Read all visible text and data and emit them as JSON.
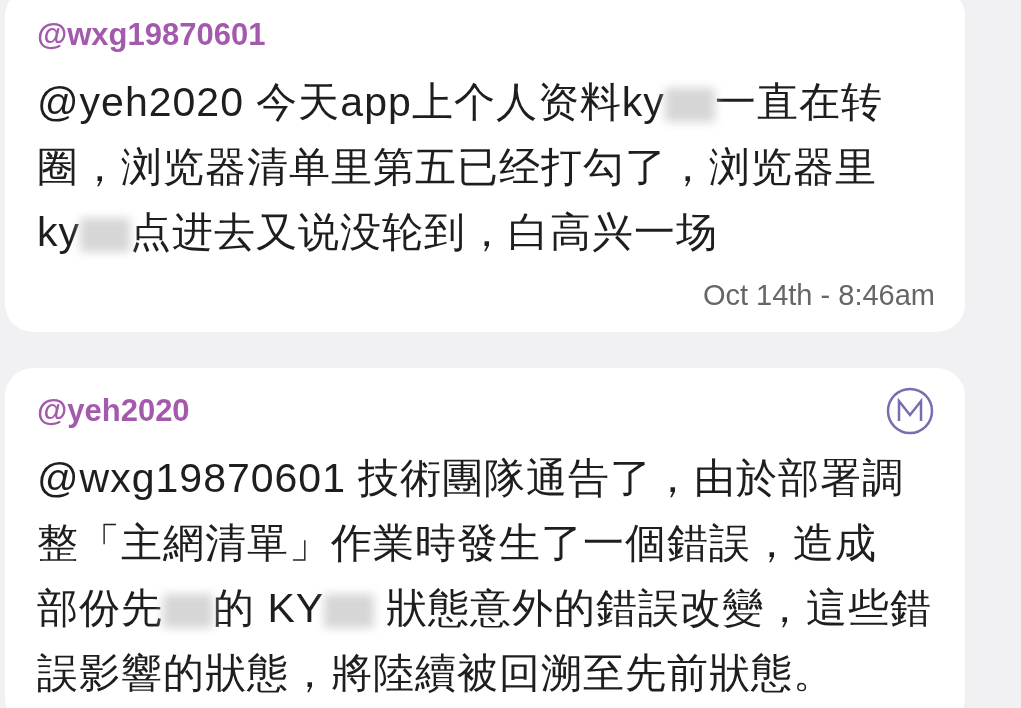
{
  "messages": [
    {
      "author": "@wxg19870601",
      "moderator": false,
      "lines": [
        [
          {
            "kind": "text",
            "text": "@yeh2020 今天app上个人资料ky"
          },
          {
            "kind": "blur"
          },
          {
            "kind": "text",
            "text": "一直在转"
          }
        ],
        [
          {
            "kind": "text",
            "text": "圈，浏览器清单里第五已经打勾了，浏览器里"
          }
        ],
        [
          {
            "kind": "text",
            "text": "ky"
          },
          {
            "kind": "blur"
          },
          {
            "kind": "text",
            "text": "点进去又说没轮到，白高兴一场"
          }
        ]
      ],
      "time": "Oct 14th - 8:46am"
    },
    {
      "author": "@yeh2020",
      "moderator": true,
      "lines": [
        [
          {
            "kind": "text",
            "text": "@wxg19870601 技術團隊通告了，由於部署調"
          }
        ],
        [
          {
            "kind": "text",
            "text": "整「主網清單」作業時發生了一個錯誤，造成"
          }
        ],
        [
          {
            "kind": "text",
            "text": "部份先"
          },
          {
            "kind": "blur"
          },
          {
            "kind": "text",
            "text": "的 KY"
          },
          {
            "kind": "blur"
          },
          {
            "kind": "text",
            "text": " 狀態意外的錯誤改變，這些錯"
          }
        ],
        [
          {
            "kind": "text",
            "text": "誤影響的狀態，將陸續被回溯至先前狀態。"
          }
        ]
      ]
    }
  ]
}
